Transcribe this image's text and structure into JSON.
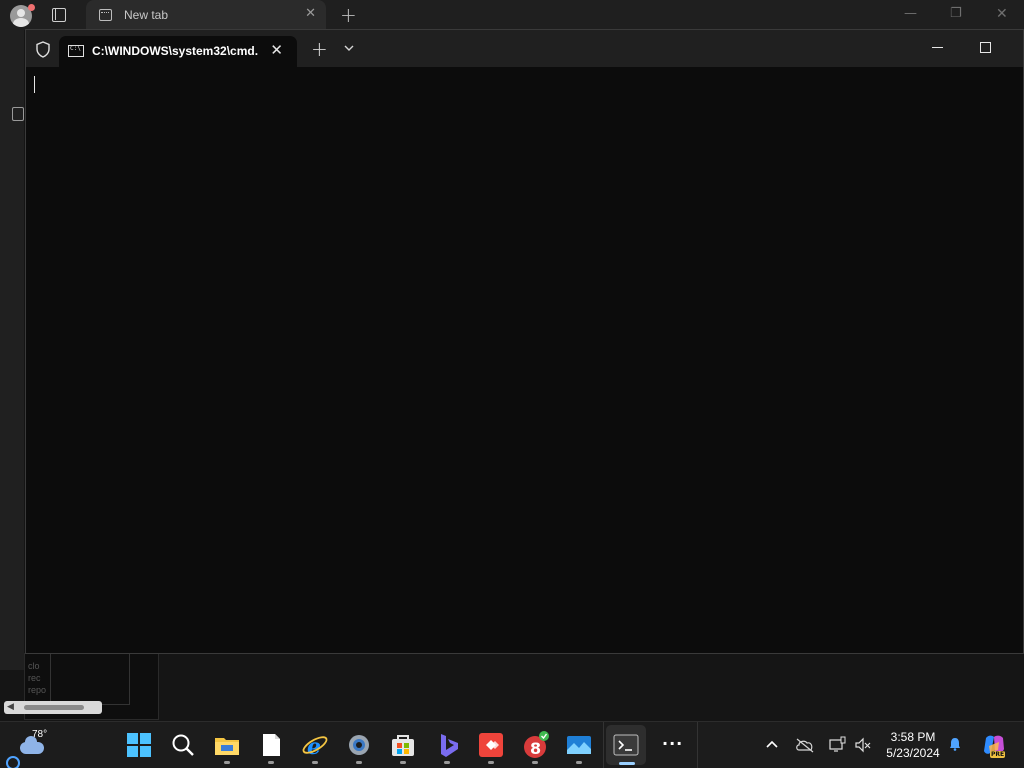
{
  "browser": {
    "tab_title": "New tab",
    "bottom_snippet": [
      "clo",
      "rec",
      "repo"
    ]
  },
  "terminal": {
    "tab_title": "C:\\WINDOWS\\system32\\cmd.",
    "tab_icon": "cmd-icon",
    "new_tab_glyph": "+",
    "close_glyph": "✕"
  },
  "taskbar": {
    "weather": {
      "temp": "78°",
      "icon": "partly-cloudy-icon"
    },
    "pinned": [
      {
        "name": "start-button",
        "icon": "windows-logo-icon"
      },
      {
        "name": "search-button",
        "icon": "search-icon"
      },
      {
        "name": "file-explorer",
        "icon": "folder-icon"
      },
      {
        "name": "notepad",
        "icon": "document-icon"
      },
      {
        "name": "internet-explorer",
        "icon": "internet-explorer-icon"
      },
      {
        "name": "settings",
        "icon": "gear-icon"
      },
      {
        "name": "microsoft-store",
        "icon": "store-icon"
      },
      {
        "name": "bing",
        "icon": "bing-icon"
      },
      {
        "name": "anydesk",
        "icon": "anydesk-icon"
      },
      {
        "name": "app-8",
        "icon": "app-8-icon"
      },
      {
        "name": "photos",
        "icon": "photos-icon"
      },
      {
        "name": "terminal",
        "icon": "terminal-icon"
      }
    ],
    "more_glyph": "···",
    "clock": {
      "time": "3:58 PM",
      "date": "5/23/2024"
    }
  },
  "colors": {
    "terminal_bg": "#0c0c0c",
    "titlebar_bg": "#202020",
    "taskbar_bg": "#1c1c1c",
    "accent": "#4fa3ff"
  }
}
